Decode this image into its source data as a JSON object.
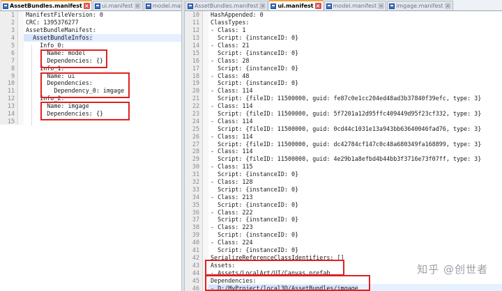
{
  "left": {
    "tabs": [
      {
        "label": "AssetBundles.manifest",
        "active": true
      },
      {
        "label": "ui.manifest",
        "active": false
      },
      {
        "label": "model.manifest",
        "active": false
      }
    ],
    "lines": [
      {
        "n": "1",
        "text": "ManifestFileVersion: 0"
      },
      {
        "n": "2",
        "text": "CRC: 1395376277"
      },
      {
        "n": "3",
        "text": "AssetBundleManifest:"
      },
      {
        "n": "4",
        "text": "  AssetBundleInfos:",
        "hl": true
      },
      {
        "n": "5",
        "text": "    Info_0:"
      },
      {
        "n": "6",
        "text": "      Name: model"
      },
      {
        "n": "7",
        "text": "      Dependencies: {}"
      },
      {
        "n": "8",
        "text": "    Info_1:"
      },
      {
        "n": "9",
        "text": "      Name: ui"
      },
      {
        "n": "10",
        "text": "      Dependencies:"
      },
      {
        "n": "11",
        "text": "        Dependency_0: imgage"
      },
      {
        "n": "12",
        "text": "    Info_2:"
      },
      {
        "n": "13",
        "text": "      Name: imgage"
      },
      {
        "n": "14",
        "text": "      Dependencies: {}"
      },
      {
        "n": "15",
        "text": ""
      }
    ]
  },
  "right": {
    "tabs": [
      {
        "label": "AssetBundles.manifest",
        "active": false
      },
      {
        "label": "ui.manifest",
        "active": true
      },
      {
        "label": "model.manifest",
        "active": false
      },
      {
        "label": "imgage.manifest",
        "active": false
      }
    ],
    "lines": [
      {
        "n": "10",
        "text": "HashAppended: 0"
      },
      {
        "n": "11",
        "text": "ClassTypes:"
      },
      {
        "n": "12",
        "text": "- Class: 1"
      },
      {
        "n": "13",
        "text": "  Script: {instanceID: 0}"
      },
      {
        "n": "14",
        "text": "- Class: 21"
      },
      {
        "n": "15",
        "text": "  Script: {instanceID: 0}"
      },
      {
        "n": "16",
        "text": "- Class: 28"
      },
      {
        "n": "17",
        "text": "  Script: {instanceID: 0}"
      },
      {
        "n": "18",
        "text": "- Class: 48"
      },
      {
        "n": "19",
        "text": "  Script: {instanceID: 0}"
      },
      {
        "n": "20",
        "text": "- Class: 114"
      },
      {
        "n": "21",
        "text": "  Script: {fileID: 11500000, guid: fe87c0e1cc204ed48ad3b37840f39efc, type: 3}"
      },
      {
        "n": "22",
        "text": "- Class: 114"
      },
      {
        "n": "23",
        "text": "  Script: {fileID: 11500000, guid: 5f7201a12d95ffc409449d95f23cf332, type: 3}"
      },
      {
        "n": "24",
        "text": "- Class: 114"
      },
      {
        "n": "25",
        "text": "  Script: {fileID: 11500000, guid: 0cd44c1031e13a943bb63640046fad76, type: 3}"
      },
      {
        "n": "26",
        "text": "- Class: 114"
      },
      {
        "n": "27",
        "text": "  Script: {fileID: 11500000, guid: dc42784cf147c0c48a680349fa168899, type: 3}"
      },
      {
        "n": "28",
        "text": "- Class: 114"
      },
      {
        "n": "29",
        "text": "  Script: {fileID: 11500000, guid: 4e29b1a8efbd4b44bb3f3716e73f07ff, type: 3}"
      },
      {
        "n": "30",
        "text": "- Class: 115"
      },
      {
        "n": "31",
        "text": "  Script: {instanceID: 0}"
      },
      {
        "n": "32",
        "text": "- Class: 128"
      },
      {
        "n": "33",
        "text": "  Script: {instanceID: 0}"
      },
      {
        "n": "34",
        "text": "- Class: 213"
      },
      {
        "n": "35",
        "text": "  Script: {instanceID: 0}"
      },
      {
        "n": "36",
        "text": "- Class: 222"
      },
      {
        "n": "37",
        "text": "  Script: {instanceID: 0}"
      },
      {
        "n": "38",
        "text": "- Class: 223"
      },
      {
        "n": "39",
        "text": "  Script: {instanceID: 0}"
      },
      {
        "n": "40",
        "text": "- Class: 224"
      },
      {
        "n": "41",
        "text": "  Script: {instanceID: 0}"
      },
      {
        "n": "42",
        "text": "SerializeReferenceClassIdentifiers: []"
      },
      {
        "n": "43",
        "text": "Assets:"
      },
      {
        "n": "44",
        "text": "- Assets/LocalArt/UI/Canvas.prefab"
      },
      {
        "n": "45",
        "text": "Dependencies:"
      },
      {
        "n": "46",
        "text": "- D:/MyProject/local3D/AssetBundles/imgage",
        "hl": true
      }
    ]
  },
  "watermark": "知乎 @创世者"
}
